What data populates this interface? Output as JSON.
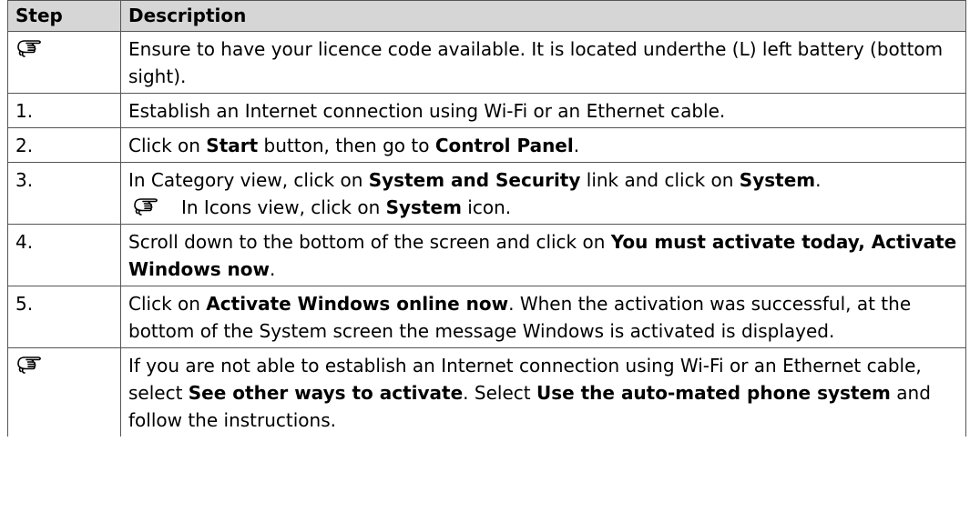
{
  "table": {
    "headers": {
      "step": "Step",
      "description": "Description"
    },
    "rows": [
      {
        "step_icon": "pointing-hand-icon",
        "description": "Ensure to have your licence code available. It is located underthe (L) left battery (bottom sight)."
      },
      {
        "step": "1.",
        "description": "Establish an Internet connection using Wi-Fi or an Ethernet cable."
      },
      {
        "step": "2.",
        "d_a": "Click on ",
        "d_b": "Start",
        "d_c": " button, then go to ",
        "d_d": "Control Panel",
        "d_e": "."
      },
      {
        "step": "3.",
        "d_a": "In Category view, click on ",
        "d_b": "System and Security",
        "d_c": " link and click on ",
        "d_d": "System",
        "d_e": ".",
        "note_icon": "pointing-hand-icon",
        "note_a": "In Icons view, click on ",
        "note_b": "System",
        "note_c": " icon."
      },
      {
        "step": "4.",
        "d_a": "Scroll down to the bottom of the screen and click on ",
        "d_b": "You must activate today, Activate Windows now",
        "d_c": "."
      },
      {
        "step": "5.",
        "d_a": "Click on ",
        "d_b": "Activate Windows online now",
        "d_c": ". When the activation was successful, at the bottom of the System screen the message Windows is activated is displayed."
      },
      {
        "step_icon": "pointing-hand-icon",
        "d_a": "If you are not able to establish an Internet connection using Wi-Fi or an Ethernet cable, select ",
        "d_b": "See other ways to activate",
        "d_c": ". Select ",
        "d_d": "Use the auto-mated phone system",
        "d_e": " and follow the instructions."
      }
    ]
  }
}
